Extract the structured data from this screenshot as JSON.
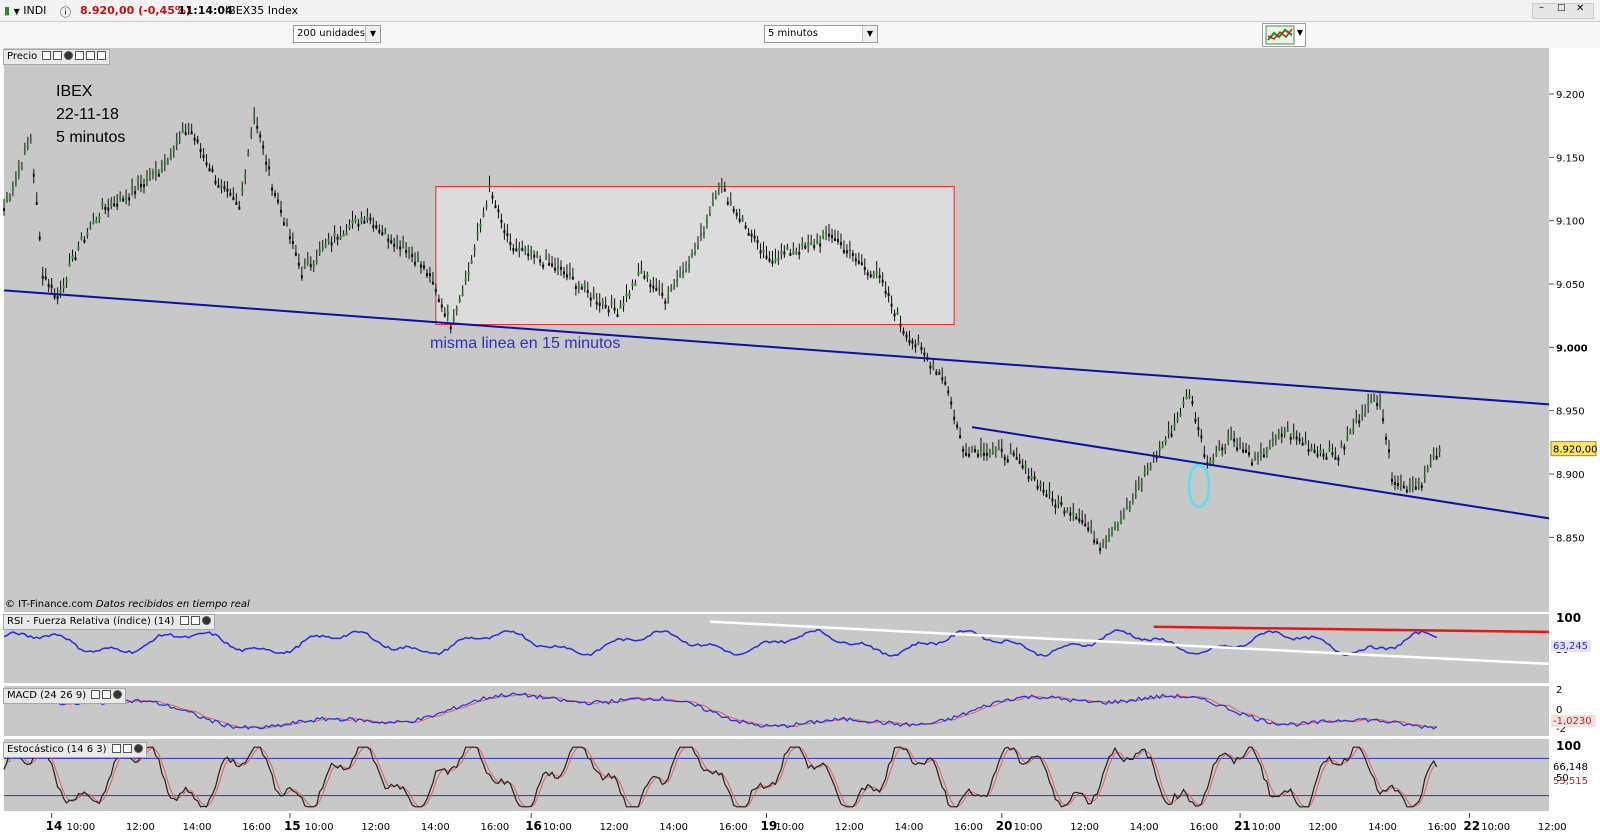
{
  "header": {
    "instrument_label": "INDI",
    "price_change": "8.920,00 (-0,45%)",
    "time": "11:14:04",
    "index_name": "IBEX35 Index"
  },
  "toolbar": {
    "units_select": "200 unidades",
    "interval_select": "5 minutos"
  },
  "panels": {
    "price_title": "Precio",
    "rsi_title": "RSI - Fuerza Relativa (índice) (14)",
    "macd_title": "MACD (24 26 9)",
    "stoch_title": "Estocástico (14 6 3)",
    "source_note": "© IT-Finance.com",
    "source_note_italic": "Datos recibidos en tiempo real"
  },
  "colors": {
    "chart_bg": "#c8c8c8",
    "trendline": "#1010a0",
    "box_border": "#e03030",
    "rsi_line": "#2a2ad8",
    "rsi_red": "#e01818",
    "macd_line": "#2a2ad8",
    "macd_signal": "#e06060",
    "stoch_k": "#202020",
    "stoch_d": "#e06060",
    "price_badge": "#ffe66a"
  },
  "chart_data": [
    {
      "type": "line",
      "name": "price",
      "annotation_title": [
        "IBEX",
        "22-11-18",
        "5 minutos"
      ],
      "annotation_note": "misma linea en 15 minutos",
      "y_ticks": [
        "9.200",
        "9.150",
        "9.100",
        "9.050",
        "9.000",
        "8.950",
        "8.900",
        "8.850"
      ],
      "y_tick_values": [
        9200,
        9150,
        9100,
        9050,
        9000,
        8950,
        8900,
        8850
      ],
      "ylim": [
        8810,
        9230
      ],
      "last_price_label": "8.920,00",
      "last_price": 8920,
      "x_day_labels": [
        "14",
        "15",
        "16",
        "19",
        "20",
        "21",
        "22"
      ],
      "x_time_labels": [
        "10:00",
        "12:00",
        "14:00",
        "16:00",
        "10:00",
        "12:00",
        "14:00",
        "16:00",
        "10:00",
        "12:00",
        "14:00",
        "16:00",
        "10:00",
        "12:00",
        "14:00",
        "16:00",
        "10:00",
        "12:00",
        "14:00",
        "16:00",
        "10:00",
        "12:00",
        "14:00",
        "16:00",
        "10:00",
        "12:00"
      ],
      "x_positions": [
        0,
        20,
        39,
        59,
        79,
        99,
        118,
        138,
        158,
        177,
        197,
        217,
        237,
        256,
        276,
        296,
        315,
        335,
        355,
        375,
        395,
        415,
        434,
        454,
        473,
        492,
        512
      ],
      "values": [
        9110,
        9140,
        9165,
        9060,
        9040,
        9080,
        9110,
        9120,
        9140,
        9175,
        9130,
        9110,
        9185,
        9130,
        9060,
        9090,
        9105,
        9090,
        9080,
        9060,
        9020,
        9060,
        9125,
        9080,
        9070,
        9060,
        9040,
        9030,
        9060,
        9040,
        9080,
        9130,
        9100,
        9070,
        9075,
        9080,
        9090,
        9070,
        9055,
        9015,
        8975,
        8920,
        8920,
        8915,
        8900,
        8880,
        8870,
        8845,
        8875,
        8905,
        8935,
        8965,
        8910,
        8930,
        8910,
        8935,
        8920,
        8915,
        8950,
        8962,
        8900,
        8890,
        8895,
        8920
      ],
      "x_index": [
        0,
        5,
        9,
        13,
        18,
        25,
        33,
        41,
        52,
        62,
        72,
        79,
        84,
        90,
        100,
        112,
        122,
        128,
        135,
        142,
        150,
        156,
        163,
        170,
        180,
        188,
        198,
        206,
        214,
        222,
        233,
        240,
        248,
        256,
        262,
        270,
        278,
        286,
        294,
        302,
        316,
        322,
        330,
        338,
        345,
        352,
        360,
        368,
        378,
        384,
        392,
        398,
        404,
        412,
        420,
        430,
        440,
        448,
        456,
        462,
        466,
        470,
        476,
        482
      ],
      "trendlines": [
        {
          "from": [
            0,
            9045
          ],
          "to": [
            512,
            8955
          ]
        },
        {
          "from": [
            325,
            8937
          ],
          "to": [
            512,
            8865
          ]
        }
      ],
      "box": {
        "x": [
          145,
          319
        ],
        "y": [
          9018,
          9127
        ]
      }
    },
    {
      "type": "line",
      "name": "RSI",
      "ylim": [
        0,
        100
      ],
      "y_ticks": [
        "100",
        "50"
      ],
      "current_label": "63,245",
      "current": 63.245
    },
    {
      "type": "line",
      "name": "MACD",
      "y_ticks": [
        "2",
        "0",
        "-2"
      ],
      "current_label": "-1,0230",
      "current": -1.023
    },
    {
      "type": "line",
      "name": "Stochastic",
      "ylim": [
        0,
        100
      ],
      "y_ticks": [
        "100",
        "50"
      ],
      "current_k_label": "66,148",
      "current_d_label": "53,515",
      "current_k": 66.148,
      "current_d": 53.515
    }
  ]
}
